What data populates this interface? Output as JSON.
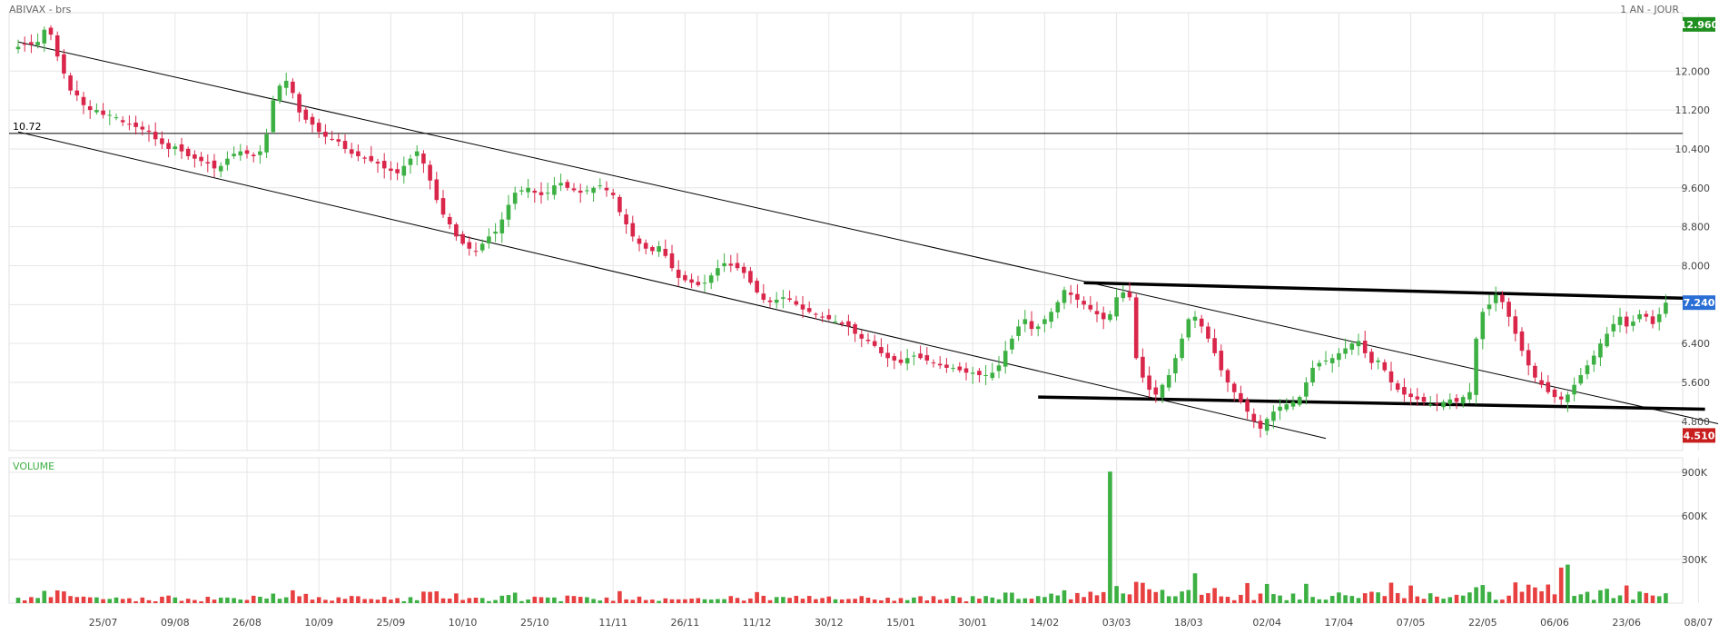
{
  "header": {
    "title": "ABIVAX - brs",
    "period": "1 AN - JOUR"
  },
  "colors": {
    "up": "#3cb043",
    "down": "#d9264a",
    "vol_up": "#3cb043",
    "vol_down": "#e84040",
    "max_badge": "#1f8f1f",
    "last_badge": "#2a6fd6",
    "min_badge": "#c81e1e",
    "grid": "#e6e6e6"
  },
  "chart_data": [
    {
      "type": "candlestick",
      "title": "ABIVAX - brs",
      "ylim": [
        4.2,
        13.2
      ],
      "y_ticks": [
        "12.000",
        "11.200",
        "10.400",
        "9.600",
        "8.800",
        "8.000",
        "7.200",
        "6.400",
        "5.600",
        "4.800"
      ],
      "x_tick_labels": [
        "25/07",
        "09/08",
        "26/08",
        "10/09",
        "25/09",
        "10/10",
        "25/10",
        "11/11",
        "26/11",
        "11/12",
        "30/12",
        "15/01",
        "30/01",
        "14/02",
        "03/03",
        "18/03",
        "02/04",
        "17/04",
        "07/05",
        "22/05",
        "06/06",
        "23/06",
        "08/07"
      ],
      "x_tick_index": [
        13,
        24,
        35,
        46,
        57,
        68,
        79,
        91,
        102,
        113,
        124,
        135,
        146,
        157,
        168,
        179,
        191,
        202,
        213,
        224,
        235,
        246,
        257
      ],
      "badges": {
        "max": "12.960",
        "last": "7.240",
        "min": "4.510"
      },
      "horizontal_level": {
        "value": 10.72,
        "label": "10.72"
      },
      "trend_lines": [
        {
          "from": [
            0,
            12.6
          ],
          "to": [
            260,
            4.75
          ],
          "weight": "thin"
        },
        {
          "from": [
            0,
            10.75
          ],
          "to": [
            200,
            4.45
          ],
          "weight": "thin"
        },
        {
          "from": [
            163,
            7.65
          ],
          "to": [
            258,
            7.32
          ],
          "weight": "bold"
        },
        {
          "from": [
            156,
            5.3
          ],
          "to": [
            258,
            5.05
          ],
          "weight": "bold"
        }
      ],
      "closes": [
        12.5,
        12.55,
        12.55,
        12.6,
        12.85,
        12.75,
        12.3,
        11.95,
        11.6,
        11.5,
        11.3,
        11.2,
        11.2,
        11.1,
        11.1,
        11.05,
        10.95,
        10.9,
        10.85,
        10.8,
        10.75,
        10.6,
        10.5,
        10.4,
        10.45,
        10.35,
        10.25,
        10.2,
        10.15,
        10.1,
        10.0,
        10.05,
        10.2,
        10.3,
        10.35,
        10.3,
        10.25,
        10.35,
        10.7,
        11.4,
        11.7,
        11.8,
        11.55,
        11.15,
        11.0,
        10.9,
        10.75,
        10.65,
        10.6,
        10.55,
        10.4,
        10.3,
        10.25,
        10.2,
        10.15,
        10.1,
        10.0,
        9.95,
        9.9,
        10.05,
        10.2,
        10.35,
        10.1,
        9.75,
        9.35,
        9.05,
        8.85,
        8.6,
        8.45,
        8.35,
        8.3,
        8.45,
        8.6,
        8.7,
        8.95,
        9.25,
        9.5,
        9.55,
        9.6,
        9.5,
        9.45,
        9.5,
        9.65,
        9.7,
        9.6,
        9.55,
        9.5,
        9.55,
        9.6,
        9.65,
        9.55,
        9.45,
        9.1,
        8.85,
        8.6,
        8.45,
        8.35,
        8.3,
        8.4,
        8.2,
        7.95,
        7.75,
        7.7,
        7.65,
        7.6,
        7.65,
        7.8,
        7.95,
        8.05,
        8.0,
        7.95,
        7.85,
        7.65,
        7.45,
        7.3,
        7.25,
        7.3,
        7.35,
        7.3,
        7.2,
        7.1,
        7.05,
        7.0,
        6.95,
        6.9,
        6.85,
        6.8,
        6.75,
        6.6,
        6.5,
        6.45,
        6.35,
        6.2,
        6.1,
        6.05,
        6.0,
        6.1,
        6.15,
        6.1,
        6.05,
        6.0,
        5.95,
        5.9,
        5.9,
        5.85,
        5.8,
        5.8,
        5.75,
        5.75,
        5.8,
        5.95,
        6.25,
        6.5,
        6.75,
        6.9,
        6.7,
        6.75,
        6.9,
        7.05,
        7.25,
        7.5,
        7.4,
        7.3,
        7.2,
        7.1,
        7.0,
        6.9,
        7.0,
        7.35,
        7.45,
        7.35,
        6.1,
        5.7,
        5.45,
        5.35,
        5.55,
        5.75,
        6.1,
        6.5,
        6.9,
        6.95,
        6.75,
        6.5,
        6.2,
        5.85,
        5.6,
        5.4,
        5.2,
        5.0,
        4.8,
        4.65,
        4.85,
        5.0,
        5.1,
        5.15,
        5.2,
        5.3,
        5.6,
        5.9,
        6.0,
        6.05,
        6.1,
        6.2,
        6.3,
        6.4,
        6.45,
        6.2,
        6.0,
        6.05,
        5.85,
        5.6,
        5.45,
        5.35,
        5.3,
        5.25,
        5.2,
        5.15,
        5.15,
        5.2,
        5.25,
        5.2,
        5.3,
        5.4,
        6.5,
        7.05,
        7.2,
        7.4,
        7.25,
        6.95,
        6.6,
        6.25,
        5.95,
        5.7,
        5.55,
        5.4,
        5.3,
        5.25,
        5.35,
        5.55,
        5.75,
        5.95,
        6.15,
        6.4,
        6.6,
        6.8,
        6.95,
        6.75,
        6.85,
        7.0,
        6.95,
        6.8,
        7.0,
        7.24
      ],
      "volume_axis": {
        "max": 1000000,
        "ticks": [
          "900K",
          "600K",
          "300K"
        ]
      },
      "volume_label": "VOLUME"
    }
  ]
}
